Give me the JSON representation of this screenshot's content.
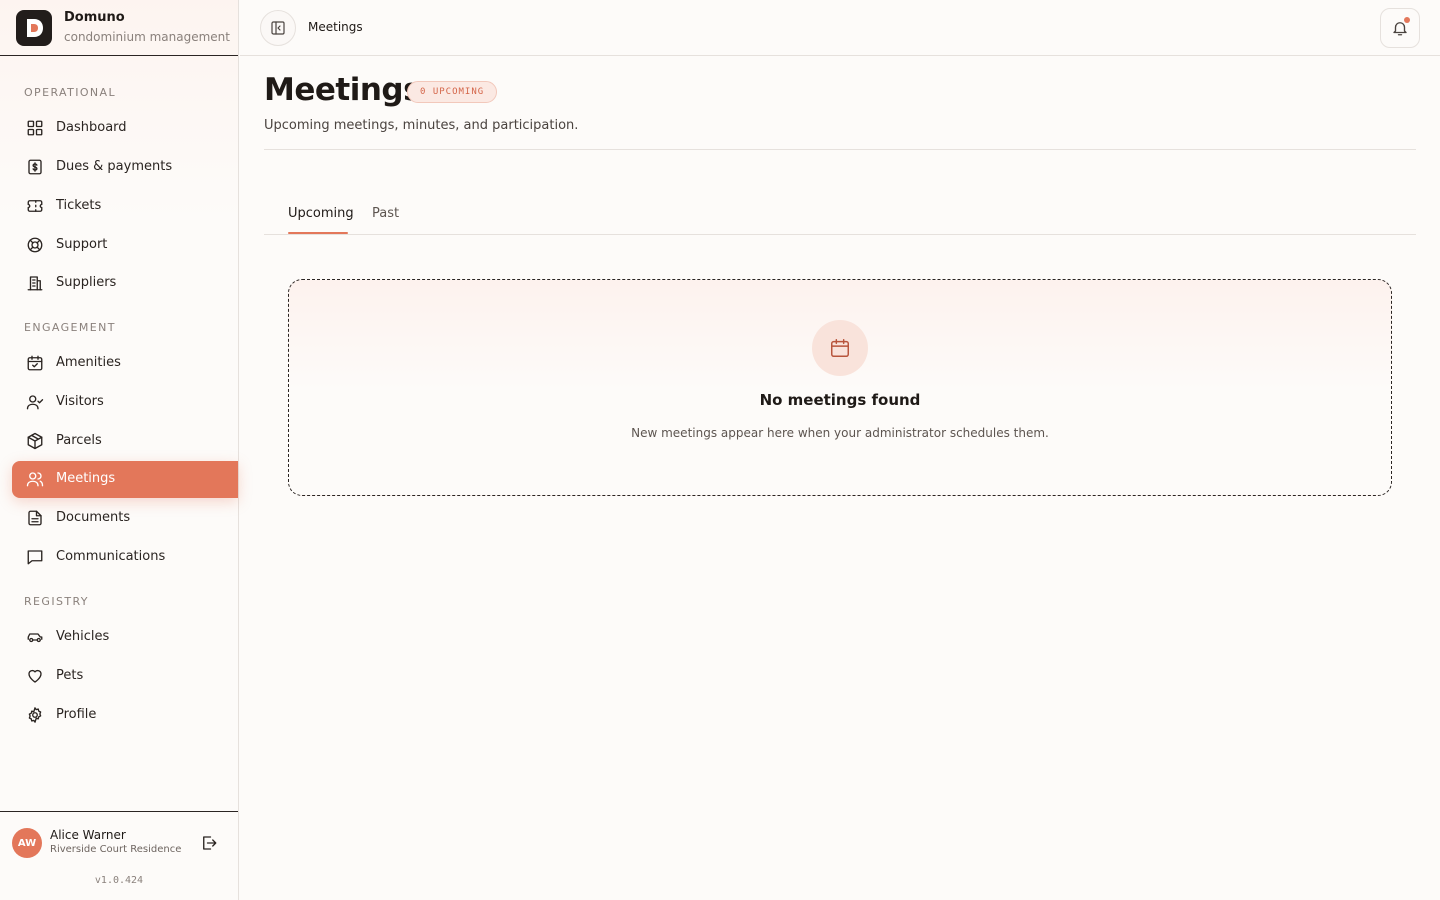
{
  "brand": {
    "name": "Domuno",
    "subtitle": "condominium management"
  },
  "sidebar": {
    "sections": [
      {
        "label": "OPERATIONAL",
        "items": [
          {
            "label": "Dashboard",
            "icon": "dashboard-grid-icon"
          },
          {
            "label": "Dues & payments",
            "icon": "dollar-receipt-icon"
          },
          {
            "label": "Tickets",
            "icon": "ticket-icon"
          },
          {
            "label": "Support",
            "icon": "lifebuoy-icon"
          },
          {
            "label": "Suppliers",
            "icon": "building-icon"
          }
        ]
      },
      {
        "label": "ENGAGEMENT",
        "items": [
          {
            "label": "Amenities",
            "icon": "calendar-check-icon"
          },
          {
            "label": "Visitors",
            "icon": "user-check-icon"
          },
          {
            "label": "Parcels",
            "icon": "package-icon"
          },
          {
            "label": "Meetings",
            "icon": "users-icon",
            "active": true
          },
          {
            "label": "Documents",
            "icon": "document-icon"
          },
          {
            "label": "Communications",
            "icon": "message-square-icon"
          }
        ]
      },
      {
        "label": "REGISTRY",
        "items": [
          {
            "label": "Vehicles",
            "icon": "car-icon"
          },
          {
            "label": "Pets",
            "icon": "heart-icon"
          },
          {
            "label": "Profile",
            "icon": "gear-icon"
          }
        ]
      }
    ]
  },
  "user": {
    "initials": "AW",
    "name": "Alice Warner",
    "residence": "Riverside Court Residence"
  },
  "version": "v1.0.424",
  "topbar": {
    "breadcrumb": "Meetings"
  },
  "page": {
    "title": "Meetings",
    "badge": "0 UPCOMING",
    "subtitle": "Upcoming meetings, minutes, and participation."
  },
  "tabs": [
    {
      "label": "Upcoming",
      "active": true
    },
    {
      "label": "Past",
      "active": false
    }
  ],
  "empty_state": {
    "title": "No meetings found",
    "description": "New meetings appear here when your administrator schedules them.",
    "icon": "calendar-icon"
  },
  "colors": {
    "accent": "#e3775a",
    "background": "#fdfbf9",
    "text": "#1f1a17"
  }
}
